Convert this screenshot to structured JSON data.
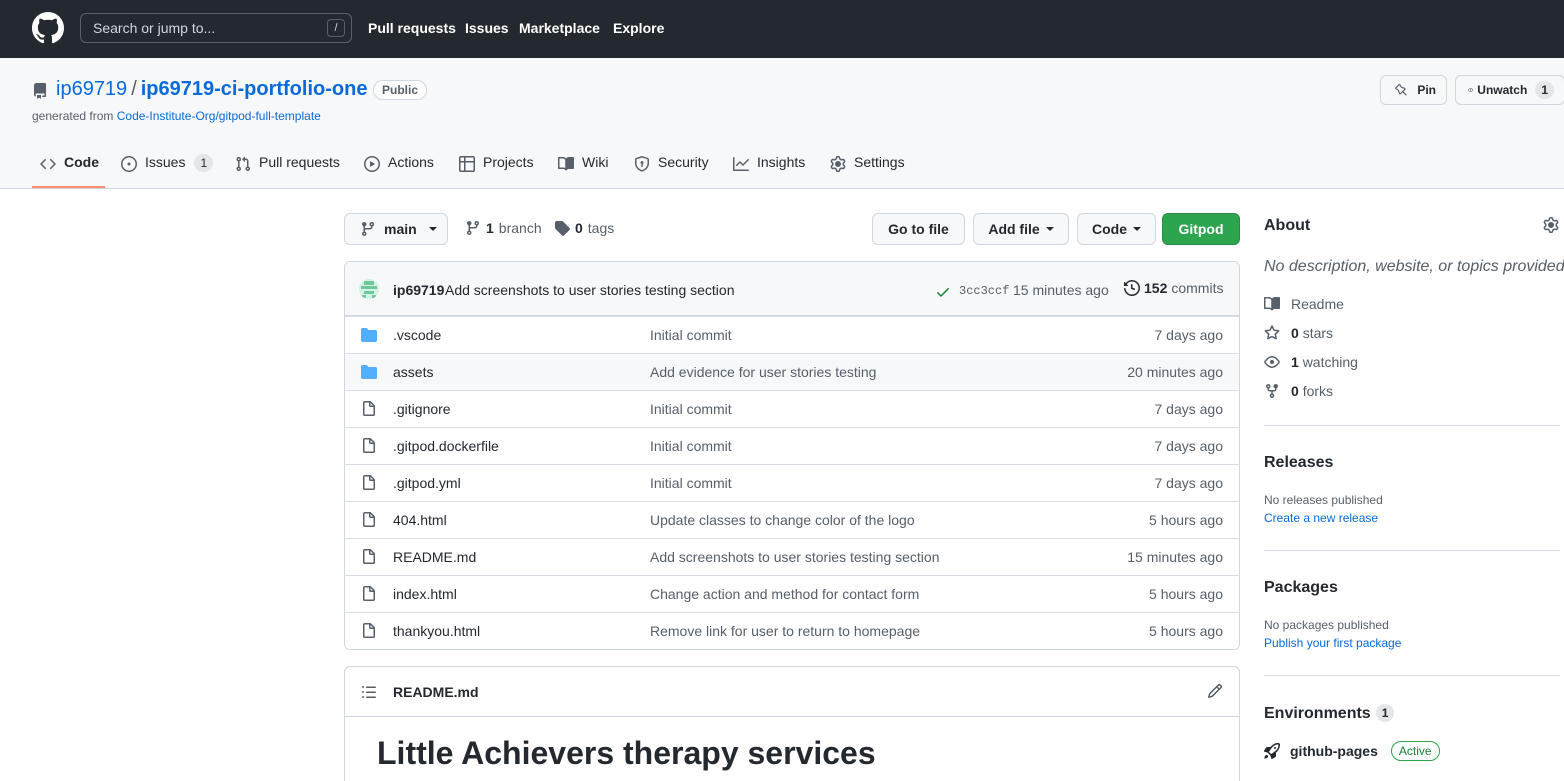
{
  "header": {
    "search_placeholder": "Search or jump to...",
    "search_shortcut": "/",
    "nav": [
      "Pull requests",
      "Issues",
      "Marketplace",
      "Explore"
    ]
  },
  "repo": {
    "owner": "ip69719",
    "separator": "/",
    "name": "ip69719-ci-portfolio-one",
    "visibility": "Public",
    "generated_prefix": "generated from",
    "template": "Code-Institute-Org/gitpod-full-template",
    "pin_label": "Pin",
    "unwatch_label": "Unwatch",
    "watch_count": "1"
  },
  "tabs": [
    {
      "label": "Code",
      "icon": "code-icon"
    },
    {
      "label": "Issues",
      "icon": "issue-icon",
      "count": "1"
    },
    {
      "label": "Pull requests",
      "icon": "pull-request-icon"
    },
    {
      "label": "Actions",
      "icon": "play-icon"
    },
    {
      "label": "Projects",
      "icon": "table-icon"
    },
    {
      "label": "Wiki",
      "icon": "book-icon"
    },
    {
      "label": "Security",
      "icon": "shield-icon"
    },
    {
      "label": "Insights",
      "icon": "graph-icon"
    },
    {
      "label": "Settings",
      "icon": "gear-icon"
    }
  ],
  "toolbar": {
    "branch": "main",
    "branch_count": "1",
    "branch_label": "branch",
    "tag_count": "0",
    "tag_label": "tags",
    "go_to_file": "Go to file",
    "add_file": "Add file",
    "code": "Code",
    "gitpod": "Gitpod"
  },
  "latest_commit": {
    "author": "ip69719",
    "message": "Add screenshots to user stories testing section",
    "sha": "3cc3ccf",
    "time": "15 minutes ago",
    "commit_count": "152",
    "commit_label": "commits"
  },
  "files": [
    {
      "name": ".vscode",
      "type": "folder",
      "message": "Initial commit",
      "age": "7 days ago"
    },
    {
      "name": "assets",
      "type": "folder",
      "message": "Add evidence for user stories testing",
      "age": "20 minutes ago"
    },
    {
      "name": ".gitignore",
      "type": "file",
      "message": "Initial commit",
      "age": "7 days ago"
    },
    {
      "name": ".gitpod.dockerfile",
      "type": "file",
      "message": "Initial commit",
      "age": "7 days ago"
    },
    {
      "name": ".gitpod.yml",
      "type": "file",
      "message": "Initial commit",
      "age": "7 days ago"
    },
    {
      "name": "404.html",
      "type": "file",
      "message": "Update classes to change color of the logo",
      "age": "5 hours ago"
    },
    {
      "name": "README.md",
      "type": "file",
      "message": "Add screenshots to user stories testing section",
      "age": "15 minutes ago"
    },
    {
      "name": "index.html",
      "type": "file",
      "message": "Change action and method for contact form",
      "age": "5 hours ago"
    },
    {
      "name": "thankyou.html",
      "type": "file",
      "message": "Remove link for user to return to homepage",
      "age": "5 hours ago"
    }
  ],
  "readme": {
    "filename": "README.md",
    "heading": "Little Achievers therapy services"
  },
  "sidebar": {
    "about_title": "About",
    "about_desc": "No description, website, or topics provided.",
    "readme_label": "Readme",
    "stars_count": "0",
    "stars_label": "stars",
    "watching_count": "1",
    "watching_label": "watching",
    "forks_count": "0",
    "forks_label": "forks",
    "releases_title": "Releases",
    "releases_empty": "No releases published",
    "releases_link": "Create a new release",
    "packages_title": "Packages",
    "packages_empty": "No packages published",
    "packages_link": "Publish your first package",
    "environments_title": "Environments",
    "environments_count": "1",
    "environment_name": "github-pages",
    "environment_status": "Active"
  },
  "colors": {
    "header_bg": "#24292f",
    "link": "#0969da",
    "primary_button": "#2da44e",
    "tab_underline": "#fd8c73"
  }
}
